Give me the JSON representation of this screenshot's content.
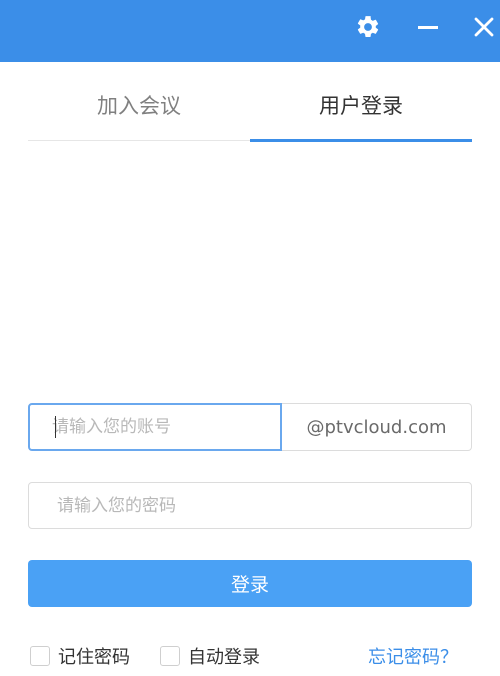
{
  "window": {
    "titlebar": {
      "settings_icon": "gear-icon",
      "minimize_icon": "minus-icon",
      "close_icon": "close-icon"
    }
  },
  "tabs": [
    {
      "label": "加入会议",
      "active": false
    },
    {
      "label": "用户登录",
      "active": true
    }
  ],
  "form": {
    "account_placeholder": "请输入您的账号",
    "account_value": "",
    "domain_suffix": "@ptvcloud.com",
    "password_placeholder": "请输入您的密码",
    "password_value": "",
    "login_label": "登录"
  },
  "options": {
    "remember_label": "记住密码",
    "remember_checked": false,
    "auto_login_label": "自动登录",
    "auto_login_checked": false,
    "forgot_label": "忘记密码？"
  },
  "colors": {
    "accent": "#3b8ee8",
    "button": "#4aa1f5"
  }
}
